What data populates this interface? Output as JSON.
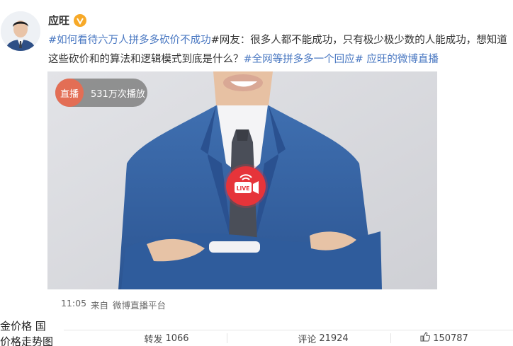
{
  "post": {
    "author": "应旺",
    "segments": [
      {
        "text": "#如何看待六万人拼多多砍价不成功",
        "tag": true
      },
      {
        "text": "#网友：很多人都不能成功，只有极少极少数的人能成功，想知道这些砍价和的算法和逻辑模式到底是什么？",
        "tag": false
      },
      {
        "text": "#全网等拼多多一个回应#",
        "tag": true
      },
      {
        "text": " ",
        "tag": false
      },
      {
        "text": "应旺的微博直播",
        "tag": true
      }
    ],
    "live_label": "直播",
    "views": "531万次播放",
    "live_badge": "LIVE",
    "time": "11:05",
    "source_prefix": "来自",
    "source": "微博直播平台"
  },
  "actions": {
    "repost_label": "转发",
    "repost_count": "1066",
    "comment_label": "评论",
    "comment_count": "21924",
    "like_count": "150787"
  },
  "sidebar_snippet": {
    "line1": "金价格 国",
    "line2": "价格走势图"
  },
  "colors": {
    "link": "#4a78c2",
    "live_red": "#e6343a",
    "verified": "#f7a928"
  }
}
